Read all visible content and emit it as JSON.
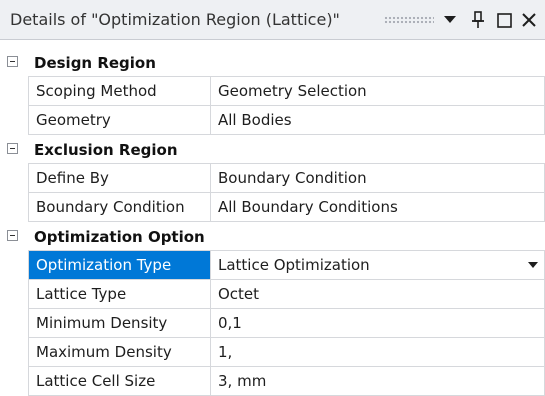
{
  "titlebar": {
    "title": "Details of \"Optimization Region (Lattice)\"",
    "icons": [
      "chevron-down-icon",
      "pin-icon",
      "maximize-icon",
      "close-icon"
    ]
  },
  "groups": [
    {
      "label": "Design Region",
      "rows": [
        {
          "name": "Scoping Method",
          "value": "Geometry Selection"
        },
        {
          "name": "Geometry",
          "value": "All Bodies"
        }
      ]
    },
    {
      "label": "Exclusion Region",
      "rows": [
        {
          "name": "Define By",
          "value": "Boundary Condition"
        },
        {
          "name": "Boundary Condition",
          "value": "All Boundary Conditions"
        }
      ]
    },
    {
      "label": "Optimization Option",
      "rows": [
        {
          "name": "Optimization Type",
          "value": "Lattice Optimization"
        },
        {
          "name": "Lattice Type",
          "value": "Octet"
        },
        {
          "name": "Minimum Density",
          "value": "0,1"
        },
        {
          "name": "Maximum Density",
          "value": "1,"
        },
        {
          "name": "Lattice Cell Size",
          "value": "3, mm"
        }
      ]
    }
  ],
  "colors": {
    "selection": "#0078d7",
    "grid_line": "#d6d8dc",
    "titlebar_bg": "#eef0f3"
  }
}
